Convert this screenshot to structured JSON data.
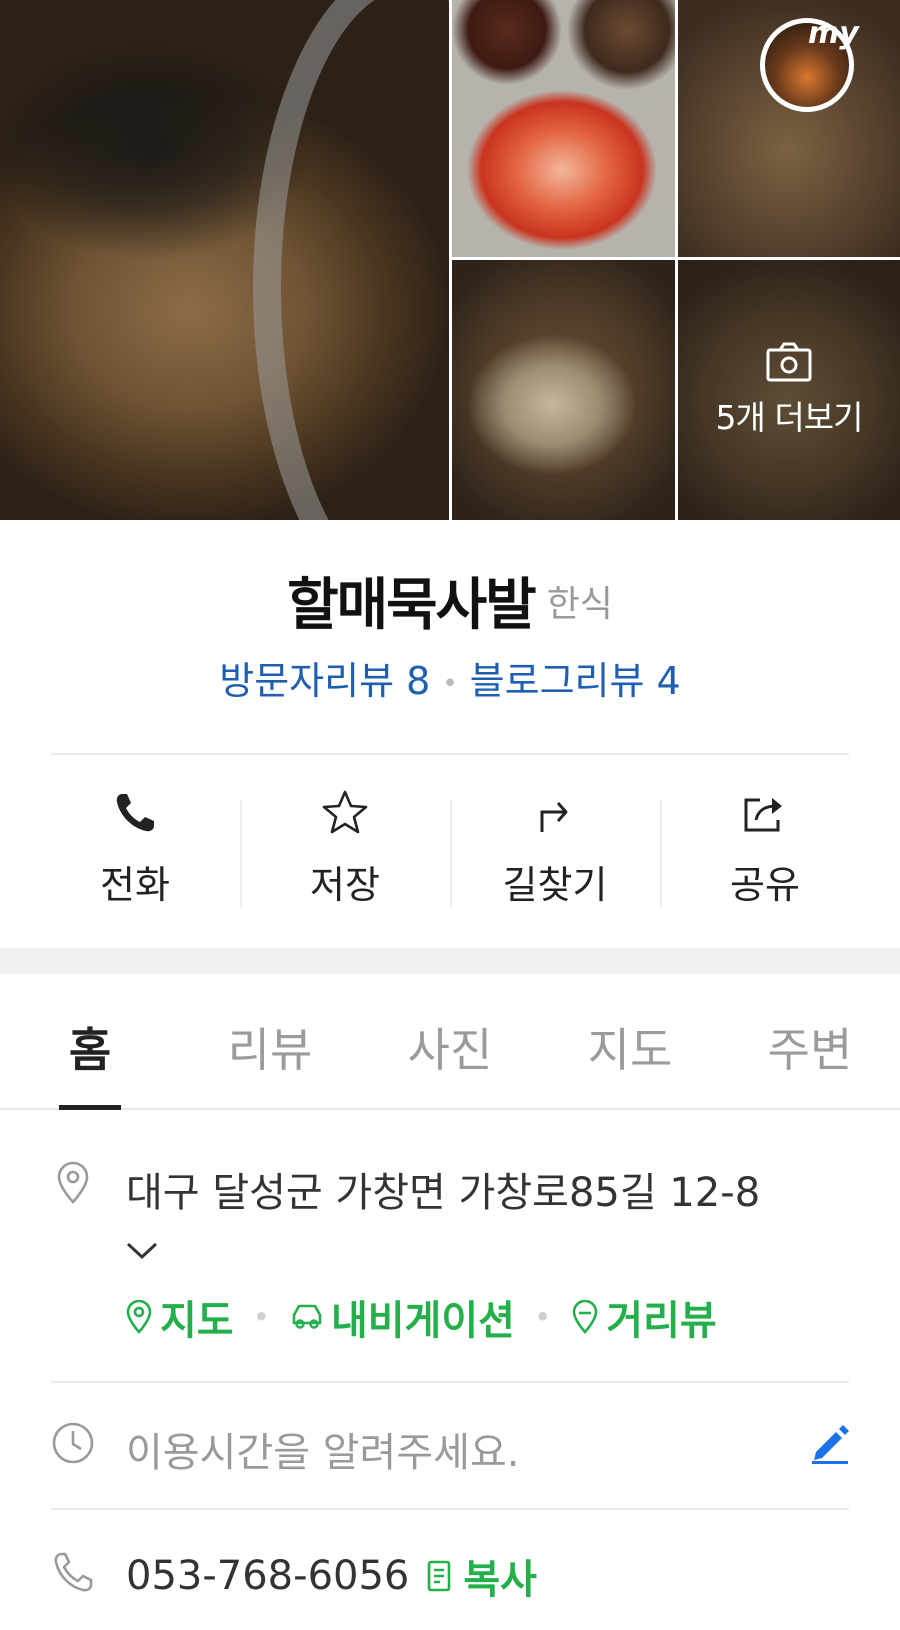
{
  "photos": {
    "more_label": "5개 더보기",
    "badge_label": "my"
  },
  "place": {
    "name": "할매묵사발",
    "category": "한식",
    "visitor_reviews": "방문자리뷰 8",
    "blog_reviews": "블로그리뷰 4"
  },
  "actions": [
    {
      "label": "전화",
      "icon": "phone-icon"
    },
    {
      "label": "저장",
      "icon": "star-icon"
    },
    {
      "label": "길찾기",
      "icon": "directions-icon"
    },
    {
      "label": "공유",
      "icon": "share-icon"
    }
  ],
  "tabs": [
    {
      "label": "홈",
      "active": true
    },
    {
      "label": "리뷰",
      "active": false
    },
    {
      "label": "사진",
      "active": false
    },
    {
      "label": "지도",
      "active": false
    },
    {
      "label": "주변",
      "active": false
    }
  ],
  "info": {
    "address": "대구 달성군 가창면 가창로85길 12-8",
    "links": {
      "map": "지도",
      "navigation": "내비게이션",
      "street_view": "거리뷰"
    },
    "hours_placeholder": "이용시간을 알려주세요.",
    "phone": "053-768-6056",
    "copy_label": "복사"
  },
  "colors": {
    "review_link": "#1f5fb0",
    "green_link": "#23b04a",
    "edit_icon": "#1a73e8"
  }
}
